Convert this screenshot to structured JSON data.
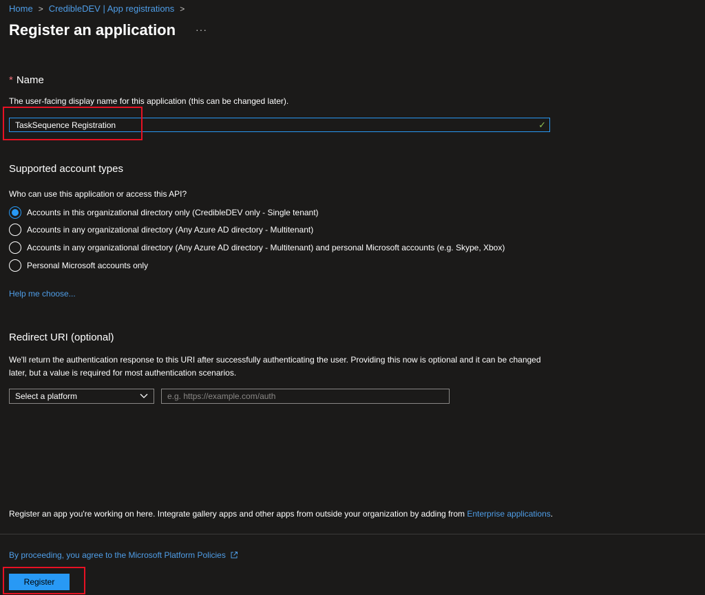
{
  "breadcrumb": {
    "items": [
      "Home",
      "CredibleDEV | App registrations"
    ],
    "separator": ">"
  },
  "page": {
    "title": "Register an application",
    "more_label": "···"
  },
  "name_section": {
    "required_mark": "*",
    "label": "Name",
    "description": "The user-facing display name for this application (this can be changed later).",
    "value": "TaskSequence Registration",
    "valid_icon": "check-icon"
  },
  "account_types": {
    "title": "Supported account types",
    "question": "Who can use this application or access this API?",
    "options": [
      "Accounts in this organizational directory only (CredibleDEV only - Single tenant)",
      "Accounts in any organizational directory (Any Azure AD directory - Multitenant)",
      "Accounts in any organizational directory (Any Azure AD directory - Multitenant) and personal Microsoft accounts (e.g. Skype, Xbox)",
      "Personal Microsoft accounts only"
    ],
    "selected_index": 0,
    "help_link": "Help me choose..."
  },
  "redirect": {
    "title": "Redirect URI (optional)",
    "description": "We'll return the authentication response to this URI after successfully authenticating the user. Providing this now is optional and it can be changed later, but a value is required for most authentication scenarios.",
    "platform_value": "Select a platform",
    "uri_placeholder": "e.g. https://example.com/auth"
  },
  "footer": {
    "note": "Register an app you're working on here. Integrate gallery apps and other apps from outside your organization by adding from ",
    "note_link": "Enterprise applications",
    "note_end": ".",
    "policy_link": "By proceeding, you agree to the Microsoft Platform Policies",
    "register_label": "Register"
  },
  "colors": {
    "background": "#1b1a19",
    "accent": "#2899f5",
    "link": "#4f9ee8",
    "highlight": "#e81123",
    "valid": "#92c353"
  }
}
